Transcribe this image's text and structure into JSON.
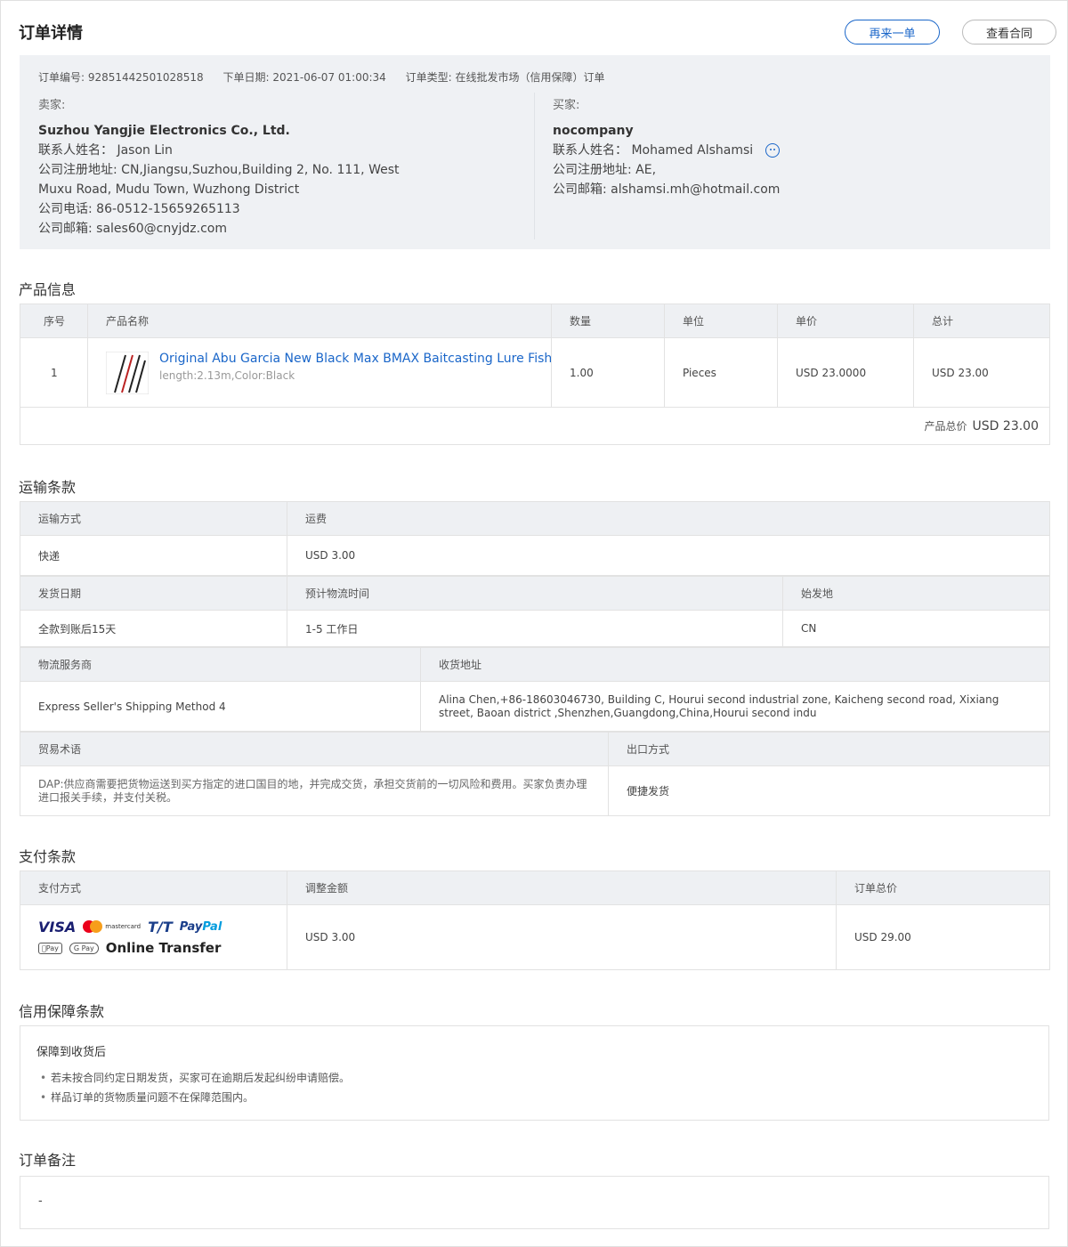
{
  "header": {
    "title": "订单详情",
    "reorder_label": "再来一单",
    "contract_label": "查看合同"
  },
  "order": {
    "number": "订单编号: 92851442501028518",
    "date": "下单日期: 2021-06-07 01:00:34",
    "type": "订单类型: 在线批发市场（信用保障）订单"
  },
  "seller": {
    "label": "卖家:",
    "company": "Suzhou Yangjie Electronics Co., Ltd.",
    "contact": "联系人姓名： Jason Lin",
    "address": "公司注册地址: CN,Jiangsu,Suzhou,Building 2, No. 111, West Muxu Road, Mudu Town, Wuzhong District",
    "phone": "公司电话: 86-0512-15659265113",
    "email": "公司邮箱: sales60@cnyjdz.com"
  },
  "buyer": {
    "label": "买家:",
    "company": "nocompany",
    "contact": "联系人姓名： Mohamed Alshamsi",
    "address": "公司注册地址: AE,",
    "email": "公司邮箱: alshamsi.mh@hotmail.com",
    "chat_icon": "chat-icon"
  },
  "products": {
    "title": "产品信息",
    "columns": [
      "序号",
      "产品名称",
      "数量",
      "单位",
      "单价",
      "总计"
    ],
    "rows": [
      {
        "index": "1",
        "name": "Original Abu Garcia New Black Max BMAX Baitcasting Lure Fishin",
        "sku": "length:2.13m,Color:Black",
        "qty": "1.00",
        "unit": "Pieces",
        "price": "USD 23.0000",
        "total": "USD 23.00"
      }
    ],
    "subtotal_label": "产品总价",
    "subtotal_value": "USD 23.00"
  },
  "shipping": {
    "title": "运输条款",
    "method_label": "运输方式",
    "fee_label": "运费",
    "method": "快递",
    "fee": "USD 3.00",
    "ship_date_label": "发货日期",
    "eta_label": "预计物流时间",
    "origin_label": "始发地",
    "ship_date": "全款到账后15天",
    "eta": "1-5 工作日",
    "origin": "CN",
    "carrier_label": "物流服务商",
    "address_label": "收货地址",
    "carrier": "Express Seller's Shipping Method 4",
    "address": "Alina Chen,+86-18603046730, Building C, Hourui second industrial zone, Kaicheng second road, Xixiang street, Baoan district      ,Shenzhen,Guangdong,China,Hourui second indu",
    "terms_label": "贸易术语",
    "export_label": "出口方式",
    "terms": "DAP:供应商需要把货物运送到买方指定的进口国目的地，并完成交货，承担交货前的一切风险和费用。买家负责办理进口报关手续，并支付关税。",
    "export": "便捷发货"
  },
  "payment": {
    "title": "支付条款",
    "method_label": "支付方式",
    "adjust_label": "调整金额",
    "total_label": "订单总价",
    "adjust": "USD 3.00",
    "total": "USD 29.00",
    "logos": {
      "visa": "VISA",
      "mastercard": "mastercard",
      "tt": "T/T",
      "paypal_a": "Pay",
      "paypal_b": "Pal",
      "applepay": "Pay",
      "gpay": "G Pay",
      "online": "Online Transfer"
    }
  },
  "guarantee": {
    "title": "信用保障条款",
    "subtitle": "保障到收货后",
    "items": [
      "若未按合同约定日期发货，买家可在逾期后发起纠纷申请赔偿。",
      "样品订单的货物质量问题不在保障范围内。"
    ]
  },
  "remark": {
    "title": "订单备注",
    "value": "-"
  }
}
